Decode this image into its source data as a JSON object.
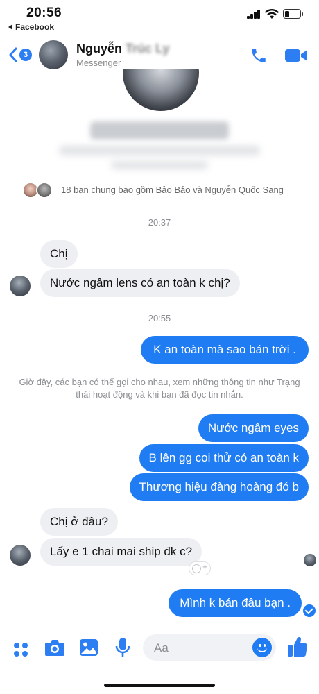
{
  "status_bar": {
    "time": "20:56",
    "back_app": "Facebook"
  },
  "header": {
    "unread_count": "3",
    "name_visible": "Nguyễn",
    "name_blurred": "Trúc Ly",
    "subtitle": "Messenger",
    "accent_color": "#2C7EF2"
  },
  "profile": {
    "mutual_friends": "18 bạn chung bao gồm Bảo Bảo và Nguyễn Quốc Sang"
  },
  "messages": {
    "time_1": "20:37",
    "m1": "Chị",
    "m2": "Nước ngâm lens có an toàn k chị?",
    "time_2": "20:55",
    "m3": "K an toàn mà sao bán trời .",
    "notice": "Giờ đây, các bạn có thể gọi cho nhau, xem những thông tin như Trạng thái hoạt động và khi bạn đã đọc tin nhắn.",
    "m4": "Nước ngâm eyes",
    "m5": "B lên gg coi thử có an toàn k",
    "m6": "Thương hiệu đàng hoàng đó b",
    "m7": "Chị ở đâu?",
    "m8": "Lấy e 1 chai mai ship đk c?",
    "m9": "Mình k bán đâu bạn ."
  },
  "composer": {
    "placeholder": "Aa",
    "icons": [
      "menu-dots-icon",
      "camera-icon",
      "gallery-icon",
      "microphone-icon",
      "emoji-icon",
      "thumbs-up-icon"
    ]
  },
  "colors": {
    "outgoing_bubble": "#1f7cf2",
    "incoming_bubble": "#eeeff2",
    "meta_text": "#8a8d91"
  }
}
